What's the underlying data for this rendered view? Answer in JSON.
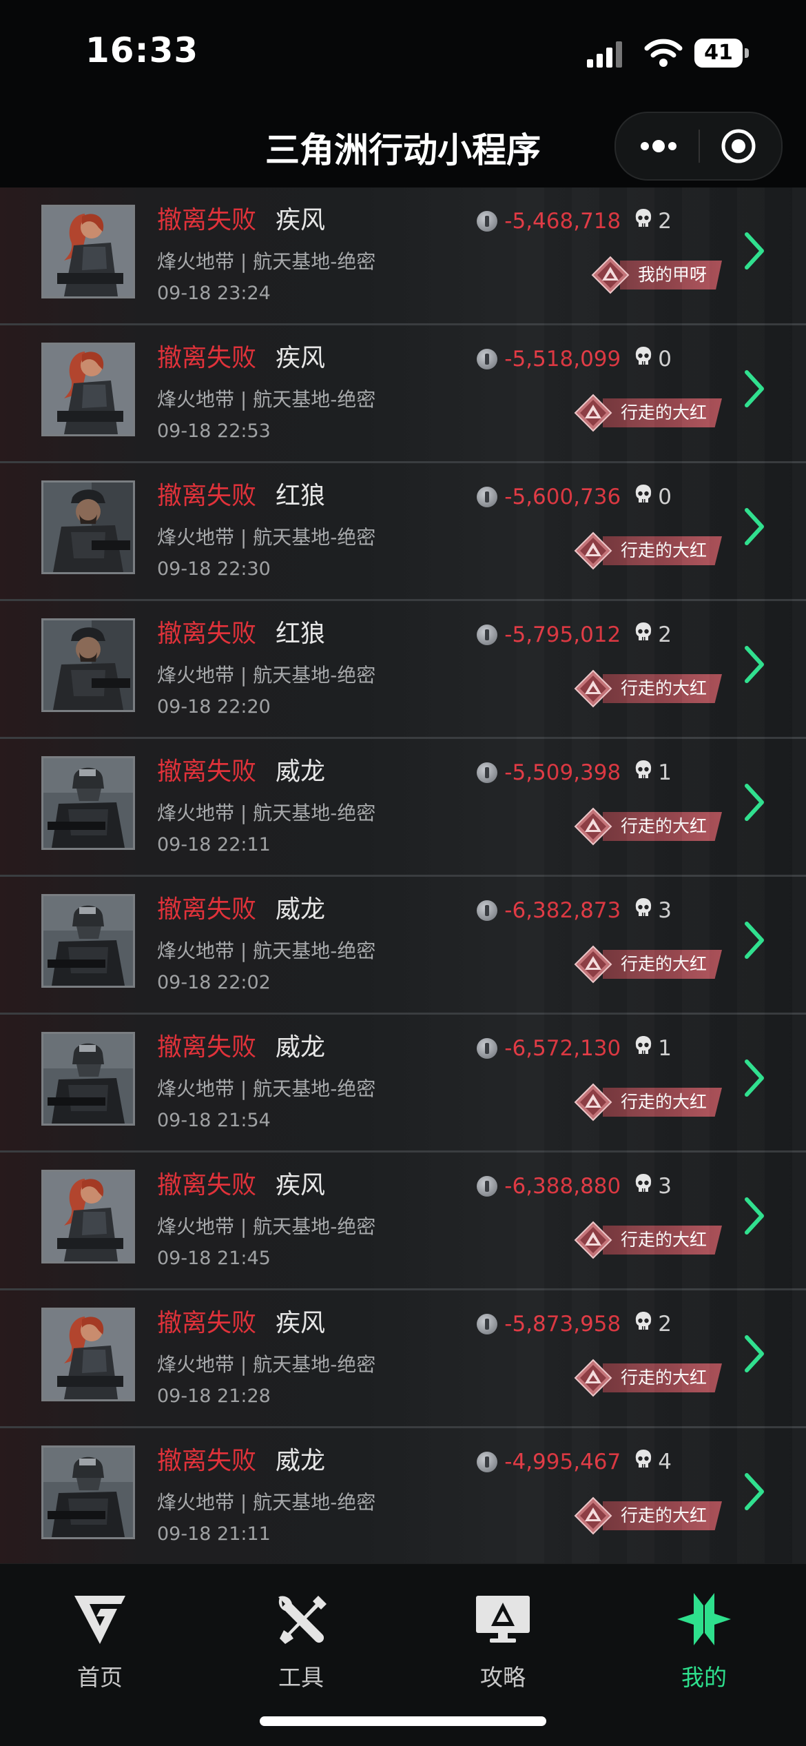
{
  "status_bar": {
    "time": "16:33",
    "battery": "41"
  },
  "header": {
    "title": "三角洲行动小程序"
  },
  "records": [
    {
      "result": "撤离失败",
      "operator": "疾风",
      "map": "烽火地带 | 航天基地-绝密",
      "date": "09-18 23:24",
      "value": "-5,468,718",
      "kills": "2",
      "tag": "我的甲呀",
      "avatar": "red-hair"
    },
    {
      "result": "撤离失败",
      "operator": "疾风",
      "map": "烽火地带 | 航天基地-绝密",
      "date": "09-18 22:53",
      "value": "-5,518,099",
      "kills": "0",
      "tag": "行走的大红",
      "avatar": "red-hair"
    },
    {
      "result": "撤离失败",
      "operator": "红狼",
      "map": "烽火地带 | 航天基地-绝密",
      "date": "09-18 22:30",
      "value": "-5,600,736",
      "kills": "0",
      "tag": "行走的大红",
      "avatar": "cap"
    },
    {
      "result": "撤离失败",
      "operator": "红狼",
      "map": "烽火地带 | 航天基地-绝密",
      "date": "09-18 22:20",
      "value": "-5,795,012",
      "kills": "2",
      "tag": "行走的大红",
      "avatar": "cap"
    },
    {
      "result": "撤离失败",
      "operator": "威龙",
      "map": "烽火地带 | 航天基地-绝密",
      "date": "09-18 22:11",
      "value": "-5,509,398",
      "kills": "1",
      "tag": "行走的大红",
      "avatar": "helmet"
    },
    {
      "result": "撤离失败",
      "operator": "威龙",
      "map": "烽火地带 | 航天基地-绝密",
      "date": "09-18 22:02",
      "value": "-6,382,873",
      "kills": "3",
      "tag": "行走的大红",
      "avatar": "helmet"
    },
    {
      "result": "撤离失败",
      "operator": "威龙",
      "map": "烽火地带 | 航天基地-绝密",
      "date": "09-18 21:54",
      "value": "-6,572,130",
      "kills": "1",
      "tag": "行走的大红",
      "avatar": "helmet"
    },
    {
      "result": "撤离失败",
      "operator": "疾风",
      "map": "烽火地带 | 航天基地-绝密",
      "date": "09-18 21:45",
      "value": "-6,388,880",
      "kills": "3",
      "tag": "行走的大红",
      "avatar": "red-hair"
    },
    {
      "result": "撤离失败",
      "operator": "疾风",
      "map": "烽火地带 | 航天基地-绝密",
      "date": "09-18 21:28",
      "value": "-5,873,958",
      "kills": "2",
      "tag": "行走的大红",
      "avatar": "red-hair"
    },
    {
      "result": "撤离失败",
      "operator": "威龙",
      "map": "烽火地带 | 航天基地-绝密",
      "date": "09-18 21:11",
      "value": "-4,995,467",
      "kills": "4",
      "tag": "行走的大红",
      "avatar": "helmet"
    }
  ],
  "tabs": [
    {
      "label": "首页",
      "icon": "home-logo-icon",
      "active": false
    },
    {
      "label": "工具",
      "icon": "tools-icon",
      "active": false
    },
    {
      "label": "攻略",
      "icon": "guide-monitor-icon",
      "active": false
    },
    {
      "label": "我的",
      "icon": "profile-logo-icon",
      "active": true
    }
  ],
  "colors": {
    "fail_red": "#e0323a",
    "value_red": "#e23a44",
    "accent_green": "#2ee08d"
  }
}
